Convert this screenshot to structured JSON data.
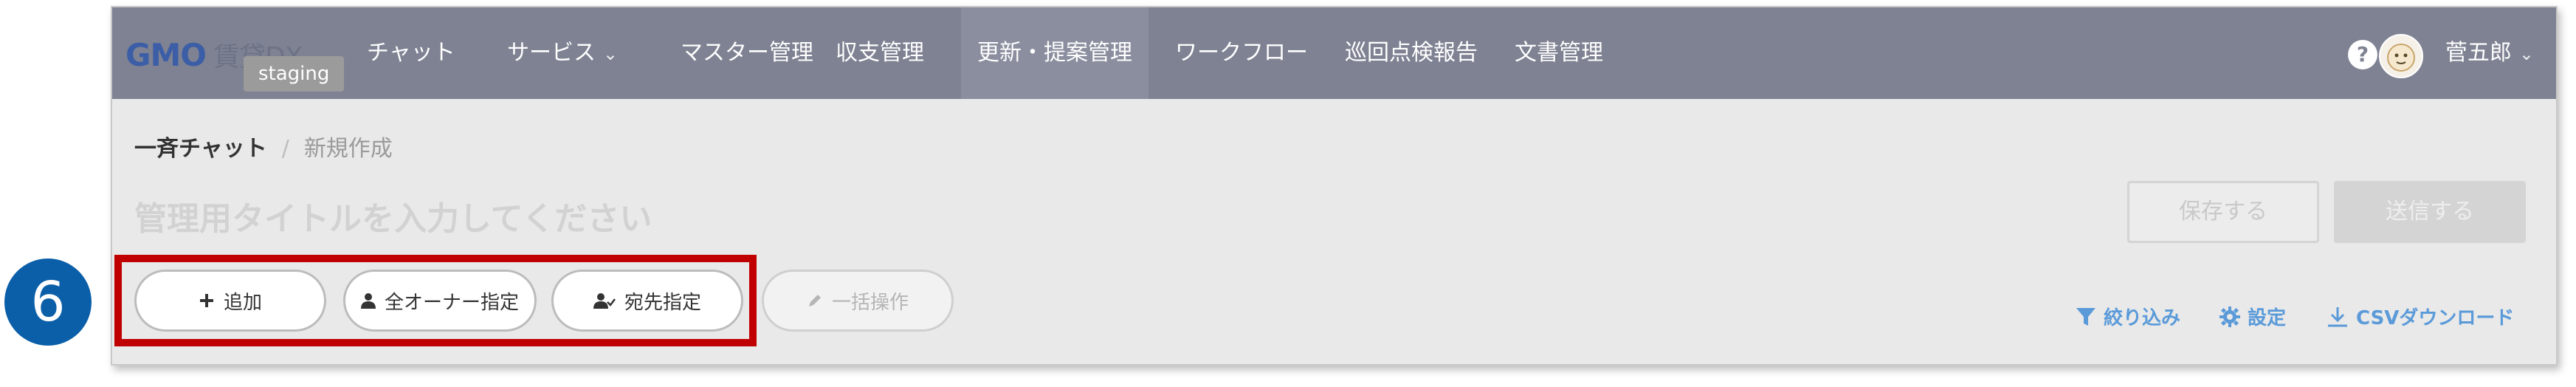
{
  "brand": {
    "logo": "GMO",
    "logo_sub": "賃貸DX",
    "env_badge": "staging"
  },
  "nav": {
    "items": [
      {
        "label": "チャット"
      },
      {
        "label": "サービス",
        "chevron": "⌄"
      },
      {
        "label": "マスター管理"
      },
      {
        "label": "収支管理"
      },
      {
        "label": "更新・提案管理"
      },
      {
        "label": "ワークフロー"
      },
      {
        "label": "巡回点検報告"
      },
      {
        "label": "文書管理"
      }
    ],
    "help": "?",
    "user_name": "菅五郎",
    "user_chevron": "⌄"
  },
  "breadcrumb": {
    "current": "一斉チャット",
    "separator": "/",
    "page": "新規作成"
  },
  "title_placeholder": "管理用タイトルを入力してください",
  "header_buttons": {
    "save": "保存する",
    "send": "送信する"
  },
  "actions": {
    "add": "追加",
    "all_owners": "全オーナー指定",
    "recipients": "宛先指定",
    "bulk": "一括操作"
  },
  "right_links": {
    "filter": "絞り込み",
    "settings": "設定",
    "csv": "CSVダウンロード"
  },
  "step_number": "6",
  "colors": {
    "nav_bg": "#7e8292",
    "link": "#5a9ad9",
    "highlight": "#c00000",
    "badge": "#0a5fa8"
  }
}
